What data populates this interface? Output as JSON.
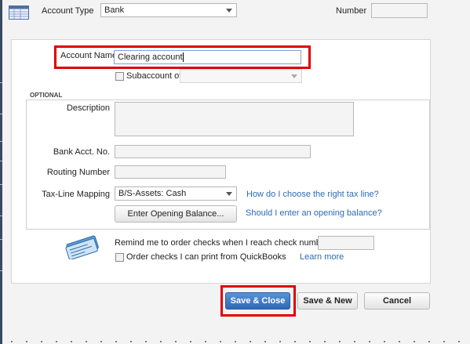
{
  "header": {
    "account_type_label": "Account Type",
    "account_type_value": "Bank",
    "number_label": "Number",
    "number_value": ""
  },
  "main": {
    "account_name_label": "Account Name",
    "account_name_value": "Clearing account",
    "subaccount_label": "Subaccount of",
    "subaccount_checked": false,
    "subaccount_value": ""
  },
  "optional": {
    "section_label": "OPTIONAL",
    "description_label": "Description",
    "description_value": "",
    "bank_acct_label": "Bank Acct. No.",
    "bank_acct_value": "",
    "routing_label": "Routing Number",
    "routing_value": "",
    "taxline_label": "Tax-Line Mapping",
    "taxline_value": "B/S-Assets: Cash",
    "taxline_help_link": "How do I choose the right tax line?",
    "opening_balance_button": "Enter Opening Balance...",
    "opening_balance_help_link": "Should I enter an opening balance?"
  },
  "checks": {
    "icon": "checkbook-icon",
    "remind_label": "Remind me to order checks when I reach check number",
    "remind_value": "",
    "order_label": "Order checks I can print from QuickBooks",
    "order_checked": false,
    "learn_more_link": "Learn more"
  },
  "footer": {
    "save_close_label": "Save & Close",
    "save_new_label": "Save & New",
    "cancel_label": "Cancel"
  },
  "colors": {
    "highlight": "#e00000",
    "primary_button": "#3a76c4",
    "link": "#2b6bb5"
  }
}
